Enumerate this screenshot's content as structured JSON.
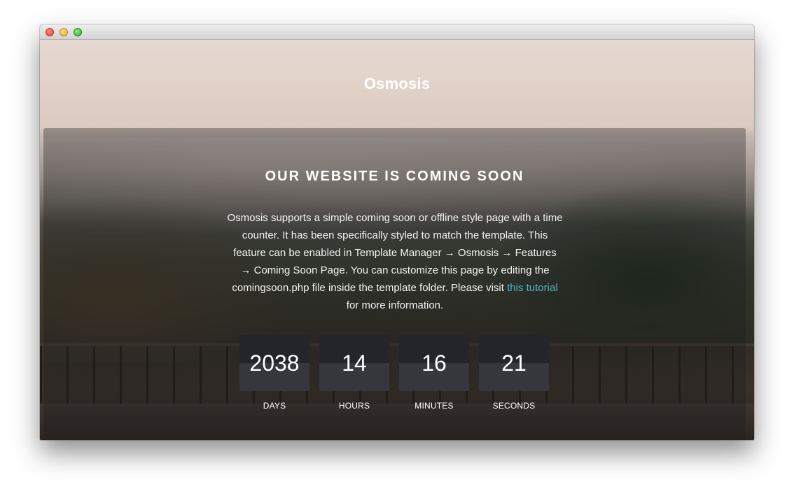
{
  "site": {
    "brand": "Osmosis"
  },
  "coming_soon": {
    "headline": "OUR WEBSITE IS COMING SOON",
    "description_before_link": "Osmosis supports a simple coming soon or offline style page with a time counter. It has been specifically styled to match the template. This feature can be enabled in Template Manager → Osmosis → Features → Coming Soon Page. You can customize this page by editing the comingsoon.php file inside the template folder. Please visit ",
    "link_text": "this tutorial",
    "description_after_link": " for more information."
  },
  "countdown": [
    {
      "value": "2038",
      "unit": "DAYS"
    },
    {
      "value": "14",
      "unit": "HOURS"
    },
    {
      "value": "16",
      "unit": "MINUTES"
    },
    {
      "value": "21",
      "unit": "SECONDS"
    }
  ],
  "colors": {
    "link": "#4fb3c4",
    "counter_top": "#24252a",
    "counter_bottom": "#35373d"
  }
}
